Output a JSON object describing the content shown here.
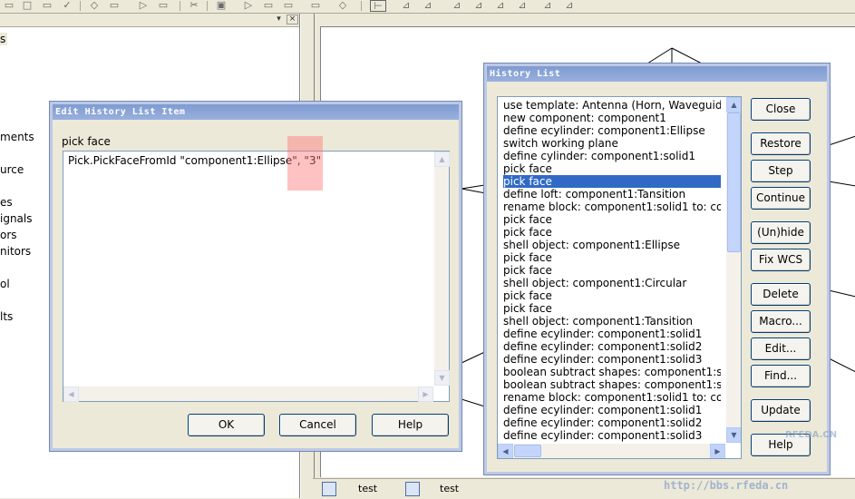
{
  "left_panel": {
    "tree_fragments": [
      "s",
      "ments",
      "urce",
      "es",
      "ignals",
      "ors",
      "nitors",
      "ol",
      "lts"
    ]
  },
  "edit_dialog": {
    "title": "Edit History List Item",
    "label": "pick face",
    "command_text": "Pick.PickFaceFromId \"component1:Ellipse\", \"3\"",
    "ok_label": "OK",
    "cancel_label": "Cancel",
    "help_label": "Help"
  },
  "history_dialog": {
    "title": "History List",
    "selected_index": 6,
    "items": [
      "use template: Antenna (Horn, Waveguide",
      "new component: component1",
      "define ecylinder: component1:Ellipse",
      "switch working plane",
      "define cylinder: component1:solid1",
      "pick face",
      "pick face",
      "define loft: component1:Tansition",
      "rename block: component1:solid1 to: com",
      "pick face",
      "pick face",
      "shell object: component1:Ellipse",
      "pick face",
      "pick face",
      "shell object: component1:Circular",
      "pick face",
      "pick face",
      "shell object: component1:Tansition",
      "define ecylinder: component1:solid1",
      "define ecylinder: component1:solid2",
      "define ecylinder: component1:solid3",
      "boolean subtract shapes: component1:so",
      "boolean subtract shapes: component1:so",
      "rename block: component1:solid1 to: com",
      "define ecylinder: component1:solid1",
      "define ecylinder: component1:solid2",
      "define ecylinder: component1:solid3"
    ],
    "buttons": {
      "close": "Close",
      "restore": "Restore",
      "step": "Step",
      "continue": "Continue",
      "unhide": "(Un)hide",
      "fix_wcs": "Fix WCS",
      "delete": "Delete",
      "macro": "Macro...",
      "edit": "Edit...",
      "find": "Find...",
      "update": "Update",
      "help": "Help"
    }
  },
  "statusbar": {
    "tab1": "test",
    "tab2": "test"
  },
  "watermark": {
    "site": "RFEDA.CN",
    "url": "http://bbs.rfeda.cn"
  }
}
